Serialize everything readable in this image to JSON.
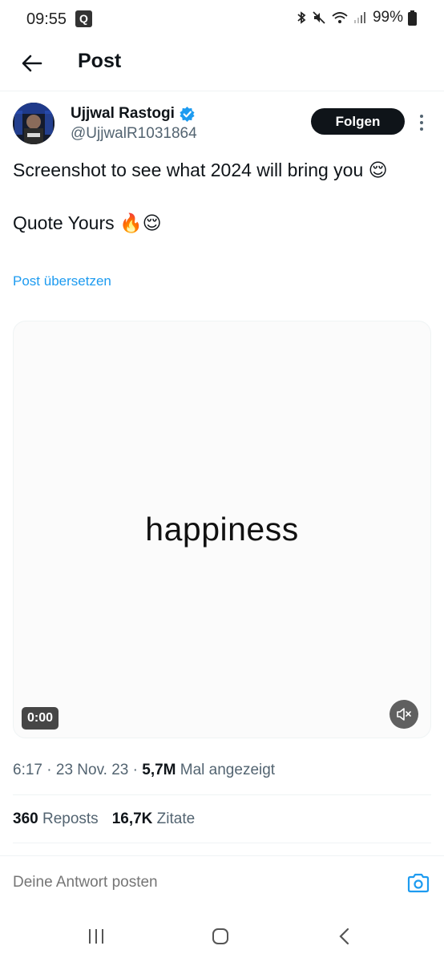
{
  "status_bar": {
    "time": "09:55",
    "notification_badge": "Q",
    "battery": "99%",
    "icons": [
      "bluetooth-icon",
      "mute-icon",
      "wifi-icon",
      "signal-icon",
      "battery-icon"
    ]
  },
  "header": {
    "title": "Post",
    "back_icon": "arrow-left-icon"
  },
  "author": {
    "name": "Ujjwal Rastogi",
    "handle": "@UjjwalR1031864",
    "verified": true,
    "follow_label": "Folgen",
    "more_icon": "more-vertical-icon"
  },
  "tweet": {
    "text": "Screenshot to see what 2024 will bring you 😌\n\nQuote Yours 🔥😌",
    "translate_label": "Post übersetzen"
  },
  "video": {
    "caption": "happiness",
    "time": "0:00",
    "mute_icon": "volume-muted-icon"
  },
  "meta": {
    "time": "6:17",
    "date": "23 Nov. 23",
    "views_count": "5,7M",
    "views_label": "Mal angezeigt"
  },
  "stats": {
    "reposts_count": "360",
    "reposts_label": "Reposts",
    "quotes_count": "16,7K",
    "quotes_label": "Zitate"
  },
  "reply": {
    "placeholder": "Deine Antwort posten",
    "camera_icon": "camera-icon"
  },
  "colors": {
    "accent": "#1d9bf0",
    "text_primary": "#0f1419",
    "text_secondary": "#536471",
    "follow_bg": "#0f1419"
  }
}
